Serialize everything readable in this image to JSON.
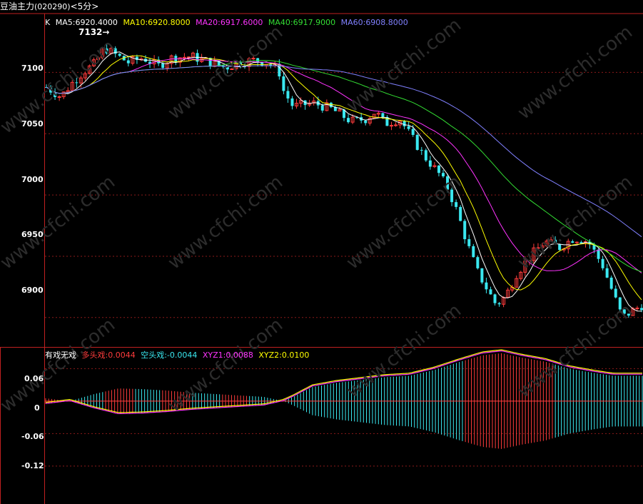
{
  "header": {
    "instrument": "豆油主力",
    "code": "(020290)",
    "period": "<5分>"
  },
  "top_legend": {
    "k": "K",
    "ma5": "MA5:6920.4000",
    "ma10": "MA10:6920.8000",
    "ma20": "MA20:6917.6000",
    "ma40": "MA40:6917.9000",
    "ma60": "MA60:6908.8000"
  },
  "high_marker": "7132",
  "bottom_legend": {
    "name": "有戏无戏",
    "bull": "多头戏:0.0044",
    "bear": "空头戏:-0.0044",
    "xyz1": "XYZ1:0.0088",
    "xyz2": "XYZ2:0.0100"
  },
  "watermark": "www.cfchi.com",
  "colors": {
    "background": "#000000",
    "up": "#ff3c3c",
    "down": "#3ae8f0",
    "ma5": "#ffffff",
    "ma10": "#ffff00",
    "ma20": "#ff33ff",
    "ma40": "#33dd33",
    "ma60": "#8080ff",
    "grid": "#8b1a1a",
    "frame": "#c02020"
  },
  "chart_data": [
    {
      "type": "candlestick",
      "title": "",
      "y_ticks": [
        "7100",
        "7050",
        "7000",
        "6950",
        "6900"
      ],
      "ylim": [
        6876,
        7148
      ],
      "bars": 139,
      "price_path_anchors": [
        [
          0,
          7088
        ],
        [
          6,
          7080
        ],
        [
          10,
          7090
        ],
        [
          15,
          7100
        ],
        [
          20,
          7107
        ],
        [
          24,
          7120
        ],
        [
          28,
          7115
        ],
        [
          34,
          7108
        ],
        [
          40,
          7112
        ],
        [
          46,
          7105
        ],
        [
          52,
          7112
        ],
        [
          60,
          7113
        ],
        [
          68,
          7108
        ],
        [
          74,
          7104
        ],
        [
          80,
          7108
        ],
        [
          86,
          7110
        ],
        [
          91,
          7108
        ],
        [
          96,
          7102
        ],
        [
          98,
          7085
        ],
        [
          102,
          7072
        ],
        [
          110,
          7075
        ],
        [
          118,
          7070
        ],
        [
          126,
          7060
        ],
        [
          132,
          7062
        ],
        [
          136,
          7068
        ],
        [
          140,
          7058
        ],
        [
          146,
          7062
        ],
        [
          150,
          7050
        ],
        [
          156,
          7032
        ],
        [
          162,
          7018
        ],
        [
          166,
          7005
        ],
        [
          170,
          6985
        ],
        [
          174,
          6960
        ],
        [
          178,
          6938
        ],
        [
          183,
          6920
        ],
        [
          186,
          6910
        ],
        [
          190,
          6918
        ],
        [
          194,
          6935
        ],
        [
          200,
          6950
        ],
        [
          206,
          6962
        ],
        [
          212,
          6957
        ],
        [
          218,
          6965
        ],
        [
          224,
          6962
        ],
        [
          230,
          6942
        ],
        [
          238,
          6900
        ],
        [
          246,
          6910
        ]
      ],
      "ma_legend": [
        "MA5",
        "MA10",
        "MA20",
        "MA40",
        "MA60"
      ]
    },
    {
      "type": "bar",
      "title": "",
      "y_ticks": [
        "0.06",
        "0",
        "-0.06",
        "-0.12"
      ],
      "ylim": [
        -0.19,
        0.1
      ],
      "series": [
        {
          "name": "多头戏",
          "color": "#ff3c3c"
        },
        {
          "name": "空头戏",
          "color": "#3ae8f0"
        },
        {
          "name": "XYZ1",
          "color": "#ff33ff"
        },
        {
          "name": "XYZ2",
          "color": "#ffff00"
        }
      ],
      "oscillator_anchors": [
        [
          0,
          0.004
        ],
        [
          10,
          0.0
        ],
        [
          20,
          0.01
        ],
        [
          30,
          0.018
        ],
        [
          40,
          0.017
        ],
        [
          50,
          0.015
        ],
        [
          60,
          0.012
        ],
        [
          70,
          0.01
        ],
        [
          80,
          0.008
        ],
        [
          90,
          0.006
        ],
        [
          98,
          0.0
        ],
        [
          102,
          -0.006
        ],
        [
          110,
          -0.02
        ],
        [
          120,
          -0.026
        ],
        [
          130,
          -0.03
        ],
        [
          140,
          -0.034
        ],
        [
          150,
          -0.036
        ],
        [
          160,
          -0.044
        ],
        [
          170,
          -0.055
        ],
        [
          180,
          -0.065
        ],
        [
          188,
          -0.068
        ],
        [
          196,
          -0.062
        ],
        [
          206,
          -0.056
        ],
        [
          216,
          -0.046
        ],
        [
          226,
          -0.04
        ],
        [
          234,
          -0.036
        ],
        [
          246,
          -0.036
        ]
      ]
    }
  ]
}
